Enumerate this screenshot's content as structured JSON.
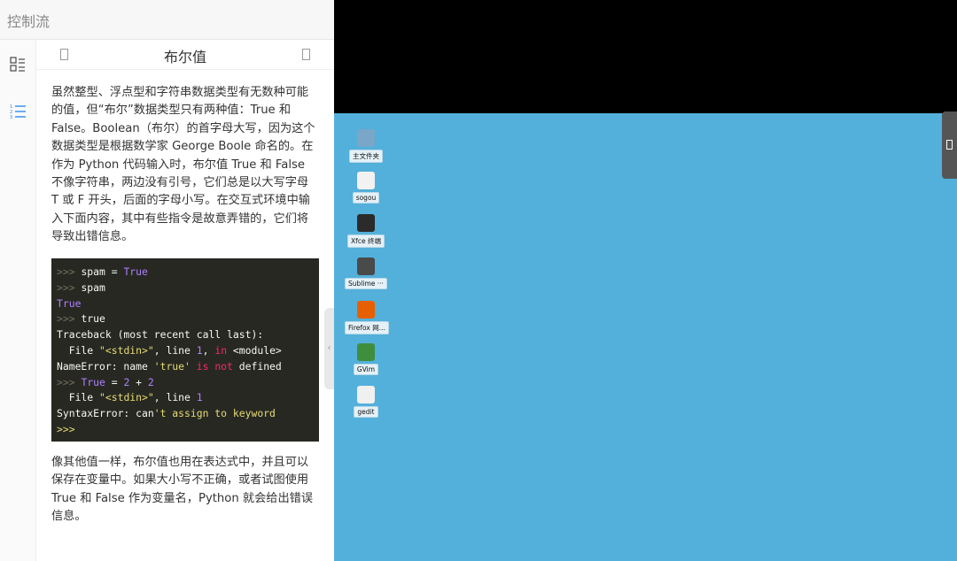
{
  "header": {
    "title": "控制流"
  },
  "sidebar": {
    "icons": [
      "outline-icon",
      "numbered-list-icon"
    ]
  },
  "section": {
    "title": "布尔值"
  },
  "paragraphs": [
    "虽然整型、浮点型和字符串数据类型有无数种可能的值，但“布尔”数据类型只有两种值：True 和 False。Boolean（布尔）的首字母大写，因为这个数据类型是根据数学家 George Boole 命名的。在作为 Python 代码输入时，布尔值 True 和 False 不像字符串，两边没有引号，它们总是以大写字母 T 或 F 开头，后面的字母小写。在交互式环境中输入下面内容，其中有些指令是故意弄错的，它们将导致出错信息。",
    "像其他值一样，布尔值也用在表达式中，并且可以保存在变量中。如果大小写不正确，或者试图使用 True 和 False 作为变量名，Python 就会给出错误信息。"
  ],
  "code": {
    "prompt": ">>>",
    "lines": [
      {
        "parts": [
          [
            ">>> ",
            "p"
          ],
          [
            "spam = ",
            ""
          ],
          [
            "True",
            "kw"
          ]
        ]
      },
      {
        "parts": [
          [
            ">>> ",
            "p"
          ],
          [
            "spam",
            ""
          ]
        ]
      },
      {
        "parts": [
          [
            "True",
            "kw"
          ]
        ]
      },
      {
        "parts": [
          [
            ">>> ",
            "p"
          ],
          [
            "true",
            ""
          ]
        ]
      },
      {
        "parts": [
          [
            "Traceback (most recent call last):",
            ""
          ]
        ]
      },
      {
        "parts": [
          [
            "  File ",
            ""
          ],
          [
            "\"<stdin>\"",
            "str"
          ],
          [
            ", line ",
            ""
          ],
          [
            "1",
            "kw"
          ],
          [
            ", ",
            ""
          ],
          [
            "in",
            "op"
          ],
          [
            " <module>",
            ""
          ]
        ]
      },
      {
        "parts": [
          [
            "NameError: name ",
            ""
          ],
          [
            "'true'",
            "str"
          ],
          [
            " ",
            ""
          ],
          [
            "is",
            "op"
          ],
          [
            " ",
            ""
          ],
          [
            "not",
            "op"
          ],
          [
            " defined",
            ""
          ]
        ]
      },
      {
        "parts": [
          [
            ">>> ",
            "p"
          ],
          [
            "True",
            "kw"
          ],
          [
            " = ",
            ""
          ],
          [
            "2",
            "kw"
          ],
          [
            " + ",
            ""
          ],
          [
            "2",
            "kw"
          ]
        ]
      },
      {
        "parts": [
          [
            "  File ",
            ""
          ],
          [
            "\"<stdin>\"",
            "str"
          ],
          [
            ", line ",
            ""
          ],
          [
            "1",
            "kw"
          ]
        ]
      },
      {
        "parts": [
          [
            "SyntaxError: can",
            ""
          ],
          [
            "'t assign to keyword",
            "str"
          ]
        ]
      },
      {
        "parts": [
          [
            ">>>",
            "str"
          ]
        ]
      }
    ]
  },
  "desktop": {
    "icons": [
      {
        "label": "主文件夹",
        "icon": "home-folder-icon",
        "color": "#7aa6c8"
      },
      {
        "label": "sogou",
        "icon": "sogou-icon",
        "color": "#f2f2f2"
      },
      {
        "label": "Xfce 终端",
        "icon": "terminal-icon",
        "color": "#2b2b2b"
      },
      {
        "label": "Sublime ···",
        "icon": "sublime-icon",
        "color": "#4a4a4a"
      },
      {
        "label": "Firefox 网...",
        "icon": "firefox-icon",
        "color": "#e66000"
      },
      {
        "label": "GVim",
        "icon": "gvim-icon",
        "color": "#3e8e3e"
      },
      {
        "label": "gedit",
        "icon": "gedit-icon",
        "color": "#f0f0f0"
      }
    ]
  }
}
